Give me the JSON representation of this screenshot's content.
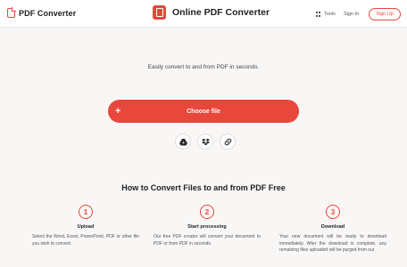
{
  "header": {
    "brand": "PDF Converter",
    "title": "Online PDF Converter",
    "tools_label": "Tools",
    "signin_label": "Sign In",
    "signup_label": "Sign Up"
  },
  "hero": {
    "tagline": "Easily convert to and from PDF in seconds.",
    "choose_label": "Choose file",
    "plus_symbol": "+",
    "sources": [
      "google-drive-icon",
      "dropbox-icon",
      "link-icon"
    ]
  },
  "howto": {
    "title": "How to Convert Files to and from PDF Free",
    "steps": [
      {
        "number": "1",
        "title": "Upload",
        "desc": "Select the Word, Excel, PowerPoint, PDF or other file you wish to convert."
      },
      {
        "number": "2",
        "title": "Start processing",
        "desc": "Our free PDF creator will convert your document to PDF or from PDF in seconds."
      },
      {
        "number": "3",
        "title": "Download",
        "desc": "Your new document will be ready to download immediately. After the download is complete, any remaining files uploaded will be purged from our"
      }
    ]
  },
  "colors": {
    "accent": "#e8473c",
    "background": "#f9f7f6"
  }
}
